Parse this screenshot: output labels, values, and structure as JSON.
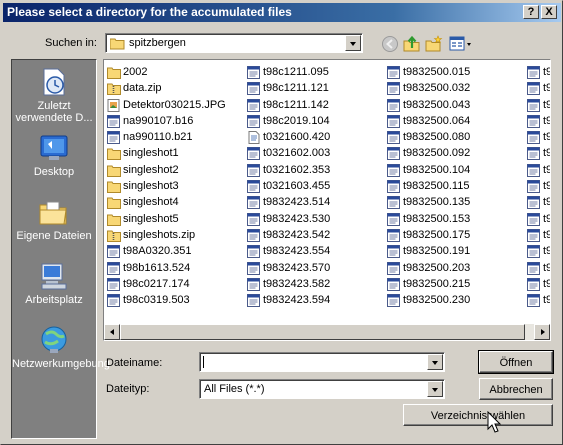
{
  "window": {
    "title": "Please select  a directory for the accumulated files",
    "help_label": "?",
    "close_label": "X"
  },
  "toolbar": {
    "lookin_label": "Suchen in:",
    "lookin_value": "spitzbergen",
    "icons": [
      "back-icon",
      "up-folder-icon",
      "new-folder-icon",
      "view-menu-icon"
    ]
  },
  "places": [
    {
      "label": "Zuletzt verwendete D...",
      "icon": "recent-documents-icon"
    },
    {
      "label": "Desktop",
      "icon": "desktop-icon"
    },
    {
      "label": "Eigene Dateien",
      "icon": "my-documents-icon"
    },
    {
      "label": "Arbeitsplatz",
      "icon": "my-computer-icon"
    },
    {
      "label": "Netzwerkumgebung",
      "icon": "network-icon"
    }
  ],
  "files": {
    "col1": [
      {
        "name": "2002",
        "type": "folder"
      },
      {
        "name": "data.zip",
        "type": "zip"
      },
      {
        "name": "Detektor030215.JPG",
        "type": "image"
      },
      {
        "name": "na990107.b16",
        "type": "binary"
      },
      {
        "name": "na990110.b21",
        "type": "binary"
      },
      {
        "name": "singleshot1",
        "type": "folder"
      },
      {
        "name": "singleshot2",
        "type": "folder"
      },
      {
        "name": "singleshot3",
        "type": "folder"
      },
      {
        "name": "singleshot4",
        "type": "folder"
      },
      {
        "name": "singleshot5",
        "type": "folder"
      },
      {
        "name": "singleshots.zip",
        "type": "zip"
      },
      {
        "name": "t98A0320.351",
        "type": "binary"
      },
      {
        "name": "t98b1613.524",
        "type": "binary"
      },
      {
        "name": "t98c0217.174",
        "type": "binary"
      },
      {
        "name": "t98c0319.503",
        "type": "binary"
      }
    ],
    "col2": [
      {
        "name": "t98c1211.095",
        "type": "binary"
      },
      {
        "name": "t98c1211.121",
        "type": "binary"
      },
      {
        "name": "t98c1211.142",
        "type": "binary"
      },
      {
        "name": "t98c2019.104",
        "type": "binary"
      },
      {
        "name": "t0321600.420",
        "type": "text"
      },
      {
        "name": "t0321602.003",
        "type": "binary"
      },
      {
        "name": "t0321602.353",
        "type": "binary"
      },
      {
        "name": "t0321603.455",
        "type": "binary"
      },
      {
        "name": "t9832423.514",
        "type": "binary"
      },
      {
        "name": "t9832423.530",
        "type": "binary"
      },
      {
        "name": "t9832423.542",
        "type": "binary"
      },
      {
        "name": "t9832423.554",
        "type": "binary"
      },
      {
        "name": "t9832423.570",
        "type": "binary"
      },
      {
        "name": "t9832423.582",
        "type": "binary"
      },
      {
        "name": "t9832423.594",
        "type": "binary"
      }
    ],
    "col3": [
      {
        "name": "t9832500.015",
        "type": "binary"
      },
      {
        "name": "t9832500.032",
        "type": "binary"
      },
      {
        "name": "t9832500.043",
        "type": "binary"
      },
      {
        "name": "t9832500.064",
        "type": "binary"
      },
      {
        "name": "t9832500.080",
        "type": "binary"
      },
      {
        "name": "t9832500.092",
        "type": "binary"
      },
      {
        "name": "t9832500.104",
        "type": "binary"
      },
      {
        "name": "t9832500.115",
        "type": "binary"
      },
      {
        "name": "t9832500.135",
        "type": "binary"
      },
      {
        "name": "t9832500.153",
        "type": "binary"
      },
      {
        "name": "t9832500.175",
        "type": "binary"
      },
      {
        "name": "t9832500.191",
        "type": "binary"
      },
      {
        "name": "t9832500.203",
        "type": "binary"
      },
      {
        "name": "t9832500.215",
        "type": "binary"
      },
      {
        "name": "t9832500.230",
        "type": "binary"
      }
    ],
    "col4": [
      {
        "name": "t9",
        "type": "binary"
      },
      {
        "name": "t9",
        "type": "binary"
      },
      {
        "name": "t9",
        "type": "binary"
      },
      {
        "name": "t9",
        "type": "binary"
      },
      {
        "name": "t9",
        "type": "binary"
      },
      {
        "name": "t9",
        "type": "binary"
      },
      {
        "name": "t9",
        "type": "binary"
      },
      {
        "name": "t9",
        "type": "binary"
      },
      {
        "name": "t9",
        "type": "binary"
      },
      {
        "name": "t9",
        "type": "binary"
      },
      {
        "name": "t9",
        "type": "binary"
      },
      {
        "name": "t9",
        "type": "binary"
      },
      {
        "name": "t9",
        "type": "binary"
      },
      {
        "name": "t9",
        "type": "binary"
      },
      {
        "name": "t9",
        "type": "binary"
      }
    ]
  },
  "form": {
    "filename_label": "Dateiname:",
    "filename_value": "",
    "filetype_label": "Dateityp:",
    "filetype_value": "All Files (*.*)"
  },
  "buttons": {
    "open_label": "Öffnen",
    "cancel_label": "Abbrechen",
    "choose_dir_label": "Verzeichnis wählen"
  },
  "colors": {
    "title_active": "#0a246a",
    "dialog_bg": "#d4d0c8",
    "places_bg": "#808080"
  }
}
